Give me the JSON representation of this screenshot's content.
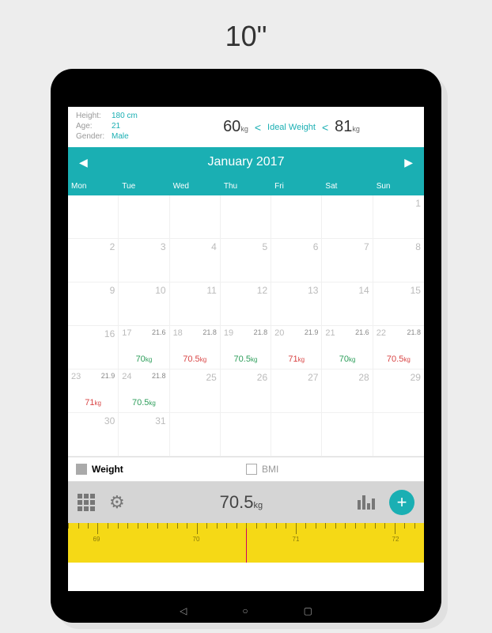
{
  "page_title": "10\"",
  "profile": {
    "height_label": "Height:",
    "height_value": "180 cm",
    "age_label": "Age:",
    "age_value": "21",
    "gender_label": "Gender:",
    "gender_value": "Male",
    "min_weight": "60",
    "max_weight": "81",
    "unit": "kg",
    "ideal_label": "Ideal Weight"
  },
  "month": "January 2017",
  "weekdays": [
    "Mon",
    "Tue",
    "Wed",
    "Thu",
    "Fri",
    "Sat",
    "Sun"
  ],
  "days": [
    {
      "n": "",
      "w": "",
      "b": "",
      "c": ""
    },
    {
      "n": "",
      "w": "",
      "b": "",
      "c": ""
    },
    {
      "n": "",
      "w": "",
      "b": "",
      "c": ""
    },
    {
      "n": "",
      "w": "",
      "b": "",
      "c": ""
    },
    {
      "n": "",
      "w": "",
      "b": "",
      "c": ""
    },
    {
      "n": "",
      "w": "",
      "b": "",
      "c": ""
    },
    {
      "n": "1",
      "w": "",
      "b": "",
      "c": ""
    },
    {
      "n": "2",
      "w": "",
      "b": "",
      "c": ""
    },
    {
      "n": "3",
      "w": "",
      "b": "",
      "c": ""
    },
    {
      "n": "4",
      "w": "",
      "b": "",
      "c": ""
    },
    {
      "n": "5",
      "w": "",
      "b": "",
      "c": ""
    },
    {
      "n": "6",
      "w": "",
      "b": "",
      "c": ""
    },
    {
      "n": "7",
      "w": "",
      "b": "",
      "c": ""
    },
    {
      "n": "8",
      "w": "",
      "b": "",
      "c": ""
    },
    {
      "n": "9",
      "w": "",
      "b": "",
      "c": ""
    },
    {
      "n": "10",
      "w": "",
      "b": "",
      "c": ""
    },
    {
      "n": "11",
      "w": "",
      "b": "",
      "c": ""
    },
    {
      "n": "12",
      "w": "",
      "b": "",
      "c": ""
    },
    {
      "n": "13",
      "w": "",
      "b": "",
      "c": ""
    },
    {
      "n": "14",
      "w": "",
      "b": "",
      "c": ""
    },
    {
      "n": "15",
      "w": "",
      "b": "",
      "c": ""
    },
    {
      "n": "16",
      "w": "",
      "b": "",
      "c": ""
    },
    {
      "n": "17",
      "w": "70",
      "b": "21.6",
      "c": "g"
    },
    {
      "n": "18",
      "w": "70.5",
      "b": "21.8",
      "c": "r"
    },
    {
      "n": "19",
      "w": "70.5",
      "b": "21.8",
      "c": "g"
    },
    {
      "n": "20",
      "w": "71",
      "b": "21.9",
      "c": "r"
    },
    {
      "n": "21",
      "w": "70",
      "b": "21.6",
      "c": "g"
    },
    {
      "n": "22",
      "w": "70.5",
      "b": "21.8",
      "c": "r"
    },
    {
      "n": "23",
      "w": "71",
      "b": "21.9",
      "c": "r"
    },
    {
      "n": "24",
      "w": "70.5",
      "b": "21.8",
      "c": "g"
    },
    {
      "n": "25",
      "w": "",
      "b": "",
      "c": ""
    },
    {
      "n": "26",
      "w": "",
      "b": "",
      "c": ""
    },
    {
      "n": "27",
      "w": "",
      "b": "",
      "c": ""
    },
    {
      "n": "28",
      "w": "",
      "b": "",
      "c": ""
    },
    {
      "n": "29",
      "w": "",
      "b": "",
      "c": ""
    },
    {
      "n": "30",
      "w": "",
      "b": "",
      "c": ""
    },
    {
      "n": "31",
      "w": "",
      "b": "",
      "c": ""
    },
    {
      "n": "",
      "w": "",
      "b": "",
      "c": ""
    },
    {
      "n": "",
      "w": "",
      "b": "",
      "c": ""
    },
    {
      "n": "",
      "w": "",
      "b": "",
      "c": ""
    },
    {
      "n": "",
      "w": "",
      "b": "",
      "c": ""
    },
    {
      "n": "",
      "w": "",
      "b": "",
      "c": ""
    }
  ],
  "wunit": "kg",
  "toggles": {
    "weight": "Weight",
    "bmi": "BMI"
  },
  "current_weight": "70.5",
  "current_unit": "kg",
  "ruler_ticks": [
    "69",
    "70",
    "71",
    "72"
  ]
}
